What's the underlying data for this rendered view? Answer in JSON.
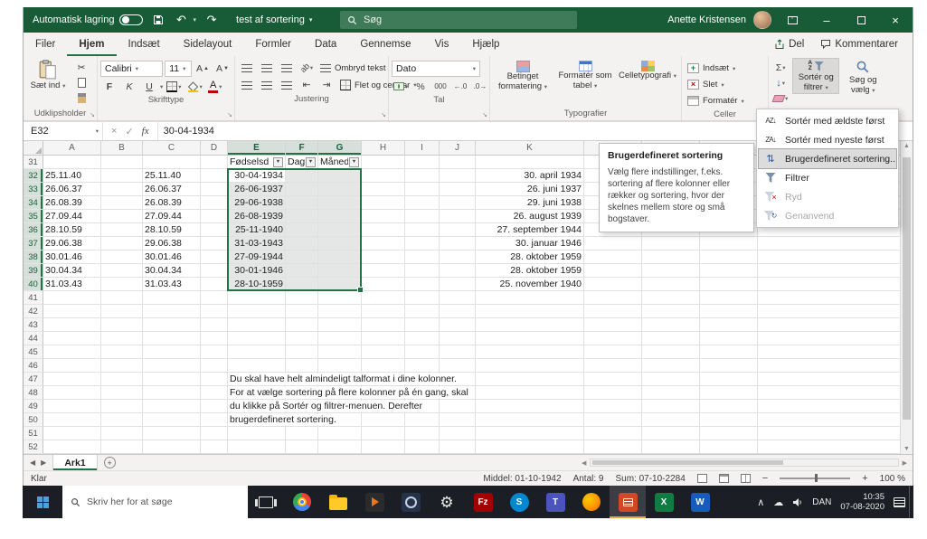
{
  "titlebar": {
    "autosave_label": "Automatisk lagring",
    "doc_title": "test af sortering",
    "search_placeholder": "Søg",
    "user_name": "Anette Kristensen"
  },
  "ribbon_tabs": {
    "tabs": [
      {
        "label": "Filer"
      },
      {
        "label": "Hjem"
      },
      {
        "label": "Indsæt"
      },
      {
        "label": "Sidelayout"
      },
      {
        "label": "Formler"
      },
      {
        "label": "Data"
      },
      {
        "label": "Gennemse"
      },
      {
        "label": "Vis"
      },
      {
        "label": "Hjælp"
      }
    ],
    "active_tab": "Hjem",
    "share_label": "Del",
    "comments_label": "Kommentarer"
  },
  "ribbon": {
    "clipboard": {
      "paste": "Sæt ind",
      "group": "Udklipsholder"
    },
    "font": {
      "family": "Calibri",
      "size": "11",
      "bold": "F",
      "italic": "K",
      "underline": "U",
      "group": "Skrifttype"
    },
    "alignment": {
      "wrap": "Ombryd tekst",
      "merge": "Flet og centrer",
      "group": "Justering"
    },
    "number": {
      "format": "Dato",
      "percent": "%",
      "thousands": "000",
      "dec_more": "←.0",
      "dec_less": ".0→",
      "group": "Tal"
    },
    "styles": {
      "conditional": "Betinget formatering",
      "format_table": "Formatér som tabel",
      "cell_styles": "Celletypografi",
      "group": "Typografier"
    },
    "cells": {
      "insert": "Indsæt",
      "delete": "Slet",
      "format": "Formatér",
      "group": "Celler"
    },
    "editing": {
      "autosum": "Σ",
      "sort_filter_line1": "Sortér og",
      "sort_filter_line2": "filtrer",
      "find_line1": "Søg og",
      "find_line2": "vælg"
    }
  },
  "sort_menu": {
    "items": [
      {
        "label": "Sortér med ældste først",
        "icon": "sort-oldest-icon",
        "enabled": true,
        "highlighted": false
      },
      {
        "label": "Sortér med nyeste først",
        "icon": "sort-newest-icon",
        "enabled": true,
        "highlighted": false
      },
      {
        "label": "Brugerdefineret sortering...",
        "icon": "custom-sort-icon",
        "enabled": true,
        "highlighted": true
      },
      {
        "label": "Filtrer",
        "icon": "filter-icon",
        "enabled": true,
        "highlighted": false
      },
      {
        "label": "Ryd",
        "icon": "clear-filter-icon",
        "enabled": false,
        "highlighted": false
      },
      {
        "label": "Genanvend",
        "icon": "reapply-icon",
        "enabled": false,
        "highlighted": false
      }
    ]
  },
  "tooltip": {
    "title": "Brugerdefineret sortering",
    "body": "Vælg flere indstillinger, f.eks. sortering af flere kolonner eller rækker og sortering, hvor der skelnes mellem store og små bogstaver."
  },
  "formula_bar": {
    "name_box": "E32",
    "value": "30-04-1934"
  },
  "grid": {
    "columns": [
      "A",
      "B",
      "C",
      "D",
      "E",
      "F",
      "G",
      "H",
      "I",
      "J",
      "K",
      "L",
      "M",
      "N"
    ],
    "first_row": 31,
    "last_row": 52,
    "filter_row": 31,
    "filter_cells": {
      "E": "Fødselsd",
      "F": "Dag",
      "G": "Måned"
    },
    "cells": {
      "32": {
        "A": "25.11.40",
        "C": "25.11.40",
        "E": "30-04-1934",
        "K": "30. april 1934"
      },
      "33": {
        "A": "26.06.37",
        "C": "26.06.37",
        "E": "26-06-1937",
        "K": "26. juni 1937"
      },
      "34": {
        "A": "26.08.39",
        "C": "26.08.39",
        "E": "29-06-1938",
        "K": "29. juni 1938"
      },
      "35": {
        "A": "27.09.44",
        "C": "27.09.44",
        "E": "26-08-1939",
        "K": "26. august 1939"
      },
      "36": {
        "A": "28.10.59",
        "C": "28.10.59",
        "E": "25-11-1940",
        "K": "27. september 1944"
      },
      "37": {
        "A": "29.06.38",
        "C": "29.06.38",
        "E": "31-03-1943",
        "K": "30. januar 1946"
      },
      "38": {
        "A": "30.01.46",
        "C": "30.01.46",
        "E": "27-09-1944",
        "K": "28. oktober 1959"
      },
      "39": {
        "A": "30.04.34",
        "C": "30.04.34",
        "E": "30-01-1946",
        "K": "28. oktober 1959"
      },
      "40": {
        "A": "31.03.43",
        "C": "31.03.43",
        "E": "28-10-1959",
        "K": "25. november 1940"
      }
    },
    "notes": {
      "47": "Du skal have helt almindeligt talformat i dine kolonner.",
      "48": "For at vælge sortering på flere kolonner på én gang, skal",
      "49": "du klikke på Sortér og filtrer-menuen. Derefter",
      "50": "brugerdefineret sortering."
    },
    "selection": {
      "col_start": "E",
      "col_end": "G",
      "row_start": 32,
      "row_end": 40,
      "active_cell": "E32"
    }
  },
  "sheet_bar": {
    "active_tab": "Ark1"
  },
  "status_bar": {
    "mode": "Klar",
    "average": "Middel: 01-10-1942",
    "count": "Antal: 9",
    "sum": "Sum: 07-10-2284",
    "zoom": "100 %"
  },
  "taskbar": {
    "search_placeholder": "Skriv her for at søge",
    "language": "DAN",
    "time": "10:35",
    "date": "07-08-2020",
    "icons": [
      {
        "name": "task-view-button",
        "kind": "taskview"
      },
      {
        "name": "chrome-icon",
        "kind": "chrome"
      },
      {
        "name": "file-explorer-icon",
        "kind": "folder"
      },
      {
        "name": "media-player-icon",
        "kind": "media"
      },
      {
        "name": "video-app-icon",
        "kind": "darkapp"
      },
      {
        "name": "settings-icon",
        "kind": "gear"
      },
      {
        "name": "filezilla-icon",
        "kind": "tile",
        "glyph": "Fz",
        "color": "#A00000"
      },
      {
        "name": "skype-icon",
        "kind": "roundtile",
        "glyph": "S",
        "color": "#0087CF"
      },
      {
        "name": "teams-icon",
        "kind": "tile",
        "glyph": "T",
        "color": "#4B53BC"
      },
      {
        "name": "firefox-icon",
        "kind": "firefox"
      },
      {
        "name": "powerpoint-icon",
        "kind": "pptlines",
        "color": "#D24726",
        "active": true
      },
      {
        "name": "excel-icon",
        "kind": "tile",
        "glyph": "X",
        "color": "#107C41"
      },
      {
        "name": "word-icon",
        "kind": "tile",
        "glyph": "W",
        "color": "#185ABD"
      }
    ]
  },
  "colors": {
    "excel_green": "#185C37",
    "accent_green": "#217346",
    "selection_fill": "#E4E7E5"
  }
}
